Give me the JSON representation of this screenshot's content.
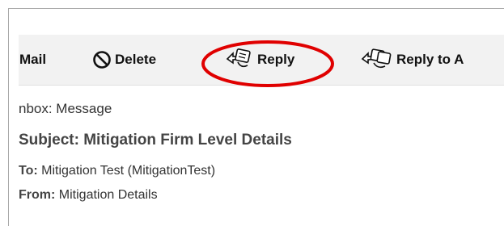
{
  "toolbar": {
    "mail_label": "Mail",
    "delete_label": "Delete",
    "reply_label": "Reply",
    "reply_all_label": "Reply to A"
  },
  "breadcrumb": "nbox: Message",
  "message": {
    "subject_label": "Subject:",
    "subject_value": "Mitigation Firm Level Details",
    "to_label": "To:",
    "to_value": "Mitigation Test (MitigationTest)",
    "from_label": "From:",
    "from_value": "Mitigation Details"
  },
  "colors": {
    "highlight": "#e00000",
    "toolbar_bg": "#f2f2f2"
  },
  "icons": [
    "delete-icon",
    "reply-icon",
    "reply-all-icon"
  ]
}
